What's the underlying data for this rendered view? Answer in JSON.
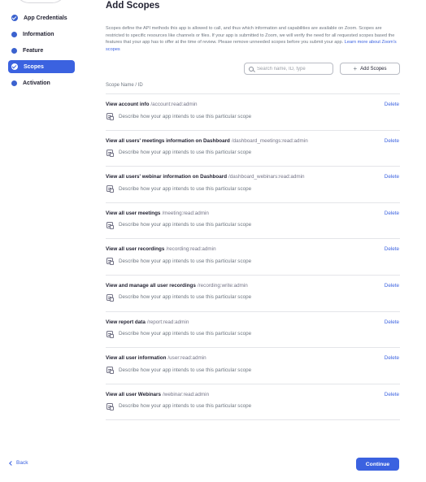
{
  "sidebar": {
    "items": [
      {
        "label": "App Credentials",
        "state": "done"
      },
      {
        "label": "Information",
        "state": "pending"
      },
      {
        "label": "Feature",
        "state": "pending"
      },
      {
        "label": "Scopes",
        "state": "active"
      },
      {
        "label": "Activation",
        "state": "pending"
      }
    ]
  },
  "main": {
    "title": "Add Scopes",
    "description": "Scopes define the API methods this app is allowed to call, and thus which information and capabilities are available on Zoom. Scopes are restricted to specific resources like channels or files. If your app is submitted to Zoom, we will verify the need for all requested scopes based the features that your app has to offer at the time of review. Please remove unneeded scopes before you submit your app.",
    "learn_more": "Learn more about Zoom's scopes",
    "search_placeholder": "Search name, ID, type",
    "add_scopes_label": "Add Scopes",
    "column_header": "Scope Name / ID",
    "delete_label": "Delete",
    "note_placeholder": "Describe how your app intends to use this particular scope"
  },
  "scopes": [
    {
      "name": "View account info",
      "id": "/account:read:admin"
    },
    {
      "name": "View all users' meetings information on Dashboard",
      "id": "/dashboard_meetings:read:admin"
    },
    {
      "name": "View all users' webinar information on Dashboard",
      "id": "/dashboard_webinars:read:admin"
    },
    {
      "name": "View all user meetings",
      "id": "/meeting:read:admin"
    },
    {
      "name": "View all user recordings",
      "id": "/recording:read:admin"
    },
    {
      "name": "View and manage all user recordings",
      "id": "/recording:write:admin"
    },
    {
      "name": "View report data",
      "id": "/report:read:admin"
    },
    {
      "name": "View all user information",
      "id": "/user:read:admin"
    },
    {
      "name": "View all user Webinars",
      "id": "/webinar:read:admin"
    }
  ],
  "footer": {
    "back_label": "Back",
    "continue_label": "Continue"
  },
  "colors": {
    "accent": "#3b62e0",
    "text": "#232333",
    "muted": "#6e7680"
  },
  "icons": [
    "check-icon",
    "dot-icon",
    "search-icon",
    "plus-icon",
    "note-icon",
    "chevron-left-icon"
  ]
}
